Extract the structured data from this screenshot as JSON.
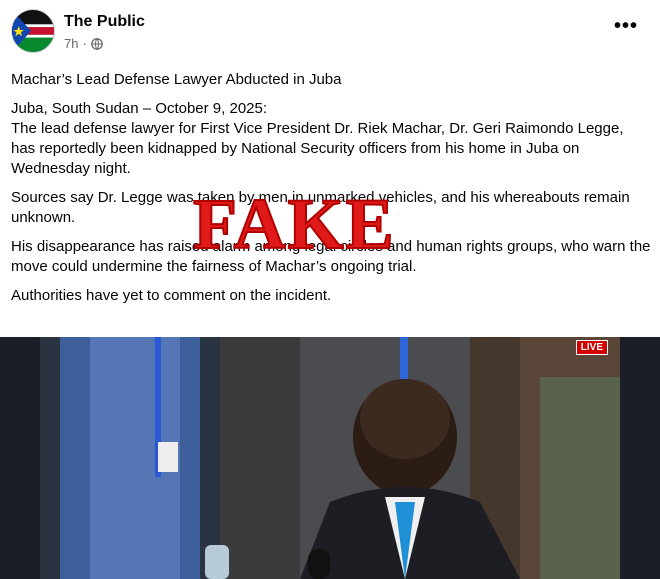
{
  "post": {
    "page_name": "The Public",
    "time": "7h",
    "dot": "·",
    "more_label": "•••",
    "avatar_text": "The Public",
    "title": "Machar’s Lead Defense Lawyer Abducted in Juba",
    "dateline": "Juba, South Sudan – October 9, 2025:",
    "para1": "The lead defense lawyer for First Vice President Dr. Riek Machar, Dr. Geri Raimondo Legge, has reportedly been kidnapped by National Security officers from his home in Juba on Wednesday night.",
    "para2": "Sources say Dr. Legge was taken by men in unmarked vehicles, and his whereabouts remain unknown.",
    "para3": "His disappearance has raised alarm among legal circles and human rights groups, who warn the move could undermine the fairness of Machar’s ongoing trial.",
    "para4": "Authorities have yet to comment on the incident."
  },
  "overlay": {
    "stamp_text": "FAKE",
    "stamp_color": "#e01919"
  },
  "media": {
    "live_label": "LIVE"
  },
  "icons": [
    "globe-icon",
    "more-options-icon"
  ]
}
